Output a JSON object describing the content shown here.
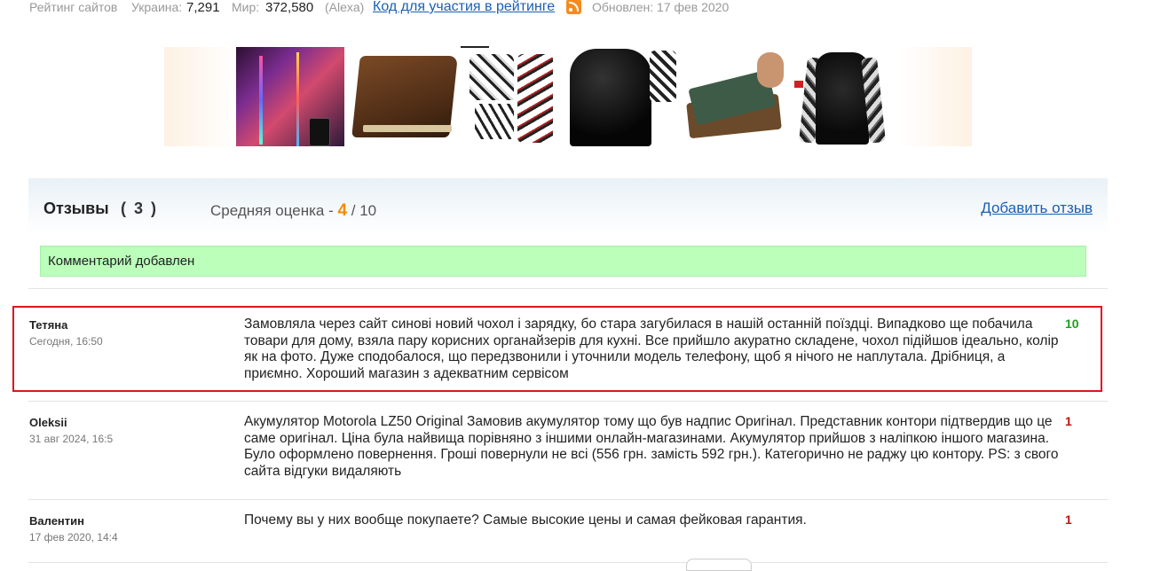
{
  "topbar": {
    "rating_label": "Рейтинг сайтов",
    "ukraine_label": "Украина:",
    "ukraine_value": "7,291",
    "world_label": "Мир:",
    "world_value": "372,580",
    "alexa": "(Alexa)",
    "code_link": "Код для участия в рейтинге",
    "updated": "Обновлен: 17 фев 2020"
  },
  "banner": {
    "products": [
      "rgb-floor-lamp",
      "leather-notebook",
      "printed-sports-set",
      "black-tshirt",
      "notebook-stack",
      "compression-longsleeve"
    ]
  },
  "reviews_header": {
    "title": "Отзывы",
    "count": "( 3 )",
    "avg_label": "Средняя оценка - ",
    "avg_score": "4",
    "avg_max": " / 10",
    "add_link": "Добавить отзыв"
  },
  "notice": "Комментарий добавлен",
  "reviews": [
    {
      "name": "Тетяна",
      "date": "Сегодня, 16:50",
      "text": "Замовляла через сайт синові новий чохол і зарядку, бо стара загубилася в нашій останній поїздці. Випадково ще побачила товари для дому, взяла пару корисних органайзерів для кухні. Все прийшло акуратно складене, чохол підійшов ідеально, колір як на фото. Дуже сподобалося, що передзвонили і уточнили модель телефону, щоб я нічого не наплутала. Дрібниця, а приємно. Хороший магазин з адекватним сервісом",
      "rating": "10"
    },
    {
      "name": "Oleksii",
      "date": "31 авг 2024, 16:5",
      "text": "Акумулятор Motorola LZ50 Original Замовив акумулятор тому що був надпис Оригінал. Представник контори підтвердив що це саме оригінал. Ціна була найвища порівняно з іншими онлайн-магазинами. Акумулятор прийшов з наліпкою іншого магазина. Було оформлено повернення. Гроші повернули не всі (556 грн. замість 592 грн.). Категорично не раджу цю контору. PS: з свого сайта відгуки видаляють",
      "rating": "1"
    },
    {
      "name": "Валентин",
      "date": "17 фев 2020, 14:4",
      "text": "Почему вы у них вообще покупаете? Самые высокие цены и самая фейковая гарантия.",
      "rating": "1"
    }
  ],
  "colors": {
    "link": "#1a5fb4",
    "highlight": "#e0151b",
    "notice_bg": "#bbffbb",
    "score": "#f08c00",
    "good_rating": "#1e9e1e",
    "bad_rating": "#c01010"
  }
}
